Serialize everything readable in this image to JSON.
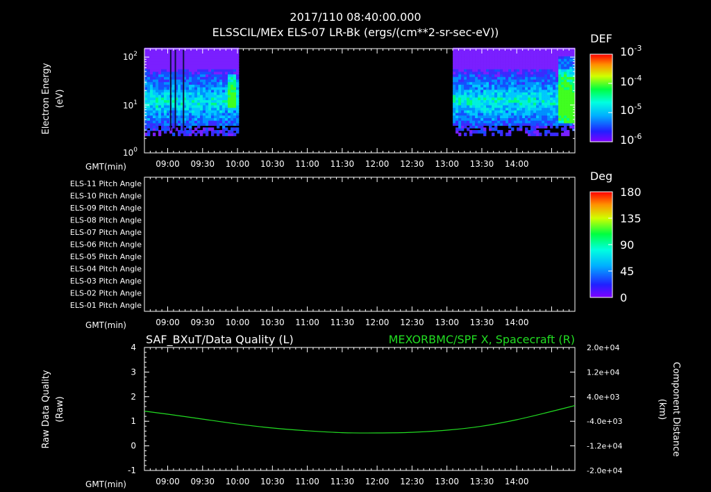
{
  "header": {
    "line1": "2017/110 08:40:00.000",
    "line2": "ELSSCIL/MEx ELS-07 LR-Bk  (ergs/(cm**2-sr-sec-eV))"
  },
  "time_axis": {
    "label": "GMT(min)",
    "tick_labels": [
      "09:00",
      "09:30",
      "10:00",
      "10:30",
      "11:00",
      "11:30",
      "12:00",
      "12:30",
      "13:00",
      "13:30",
      "14:00"
    ]
  },
  "panel1": {
    "ylabel_line1": "Electron Energy",
    "ylabel_line2": "(eV)",
    "ytick_base": "10",
    "yticks": [
      {
        "exp": "2"
      },
      {
        "exp": "1"
      },
      {
        "exp": "0"
      }
    ],
    "colorbar": {
      "title": "DEF",
      "base": "10",
      "labels": [
        {
          "exp": "-3"
        },
        {
          "exp": "-4"
        },
        {
          "exp": "-5"
        },
        {
          "exp": "-6"
        }
      ]
    },
    "data_segments": [
      {
        "start": "08:40",
        "end": "10:00"
      },
      {
        "start": "13:05",
        "end": "14:50"
      }
    ]
  },
  "panel2": {
    "row_labels": [
      "ELS-11 Pitch Angle",
      "ELS-10 Pitch Angle",
      "ELS-09 Pitch Angle",
      "ELS-08 Pitch Angle",
      "ELS-07 Pitch Angle",
      "ELS-06 Pitch Angle",
      "ELS-05 Pitch Angle",
      "ELS-04 Pitch Angle",
      "ELS-03 Pitch Angle",
      "ELS-02 Pitch Angle",
      "ELS-01 Pitch Angle"
    ],
    "colorbar": {
      "title": "Deg",
      "labels": [
        "180",
        "135",
        "90",
        "45",
        "0"
      ]
    }
  },
  "panel3": {
    "left_title": "SAF_BXuT/Data Quality (L)",
    "right_title": "MEXORBMC/SPF X, Spacecraft (R)",
    "ylabel_left_line1": "Raw Data Quality",
    "ylabel_left_line2": "(Raw)",
    "ylabel_right_line1": "Component Distance",
    "ylabel_right_line2": "(km)",
    "left_ticks": [
      "4",
      "3",
      "2",
      "1",
      "0",
      "-1"
    ],
    "right_ticks": [
      "2.0e+04",
      "1.2e+04",
      "4.0e+03",
      "-4.0e+03",
      "-1.2e+04",
      "-2.0e+04"
    ],
    "line_color": "#22dd22"
  },
  "chart_data": [
    {
      "type": "heatmap",
      "title": "ELSSCIL/MEx ELS-07 LR-Bk  (ergs/(cm**2-sr-sec-eV))",
      "xlabel": "GMT(min)",
      "ylabel": "Electron Energy (eV)",
      "x_range": [
        "08:40",
        "14:50"
      ],
      "ylim": [
        1,
        150
      ],
      "yscale": "log",
      "colorbar_label": "DEF",
      "color_range": [
        1e-06,
        0.001
      ],
      "color_scale": "log",
      "data_coverage": [
        [
          "08:40",
          "10:00"
        ],
        [
          "13:05",
          "14:50"
        ]
      ]
    },
    {
      "type": "heatmap",
      "title": "",
      "xlabel": "GMT(min)",
      "rows": [
        "ELS-11 Pitch Angle",
        "ELS-10 Pitch Angle",
        "ELS-09 Pitch Angle",
        "ELS-08 Pitch Angle",
        "ELS-07 Pitch Angle",
        "ELS-06 Pitch Angle",
        "ELS-05 Pitch Angle",
        "ELS-04 Pitch Angle",
        "ELS-03 Pitch Angle",
        "ELS-02 Pitch Angle",
        "ELS-01 Pitch Angle"
      ],
      "colorbar_label": "Deg",
      "color_range": [
        0,
        180
      ],
      "values": []
    },
    {
      "type": "line",
      "title_left": "SAF_BXuT/Data Quality (L)",
      "title_right": "MEXORBMC/SPF X, Spacecraft (R)",
      "xlabel": "GMT(min)",
      "ylabel_left": "Raw Data Quality (Raw)",
      "ylabel_right": "Component Distance (km)",
      "ylim_left": [
        -1,
        4
      ],
      "ylim_right": [
        -20000,
        20000
      ],
      "series": [
        {
          "name": "MEXORBMC/SPF X, Spacecraft (R)",
          "axis": "right",
          "x": [
            "08:40",
            "09:00",
            "09:30",
            "10:00",
            "10:30",
            "11:00",
            "11:30",
            "12:00",
            "12:30",
            "13:00",
            "13:30",
            "14:00",
            "14:30",
            "14:50"
          ],
          "y": [
            -700,
            -1700,
            -3300,
            -4900,
            -6200,
            -7100,
            -7700,
            -7800,
            -7600,
            -6900,
            -5600,
            -3500,
            -800,
            1100
          ]
        }
      ]
    }
  ]
}
